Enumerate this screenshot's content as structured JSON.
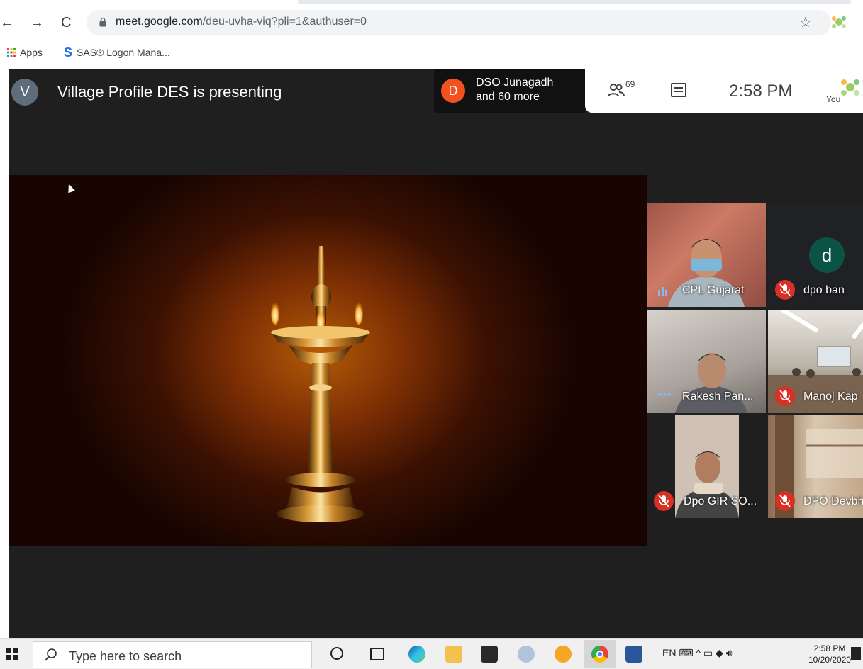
{
  "browser": {
    "url_host": "meet.google.com",
    "url_path": "/deu-uvha-viq?pli=1&authuser=0",
    "nav": {
      "back": "←",
      "forward": "→",
      "reload": "C"
    },
    "bookmarks": [
      {
        "label": "Apps"
      },
      {
        "label": "SAS® Logon Mana..."
      }
    ]
  },
  "meet": {
    "presenter_initial": "V",
    "presenting_text": "Village Profile DES is presenting",
    "participants_chip": {
      "initial": "D",
      "line1": "DSO Junagadh",
      "line2": "and 60 more"
    },
    "people_count": "69",
    "time": "2:58 PM",
    "you_label": "You",
    "tiles": [
      {
        "name": "CPL Gujarat",
        "muted": false
      },
      {
        "name": "dpo ban",
        "muted": true,
        "initial": "d"
      },
      {
        "name": "Rakesh Pan...",
        "muted": false
      },
      {
        "name": "Manoj Kap",
        "muted": true
      },
      {
        "name": "Dpo GIR SO...",
        "muted": true
      },
      {
        "name": "DPO Devbh",
        "muted": true
      }
    ]
  },
  "taskbar": {
    "search_placeholder": "Type here to search",
    "tray_lang": "EN",
    "clock_time": "2:58 PM",
    "clock_date": "10/20/2020"
  },
  "colors": {
    "meet_bg": "#1f1f1f",
    "presenter_avatar": "#5f6d7a",
    "participant_avatar": "#f4511e",
    "mute_red": "#d93025",
    "dpo_avatar": "#0b5345"
  }
}
